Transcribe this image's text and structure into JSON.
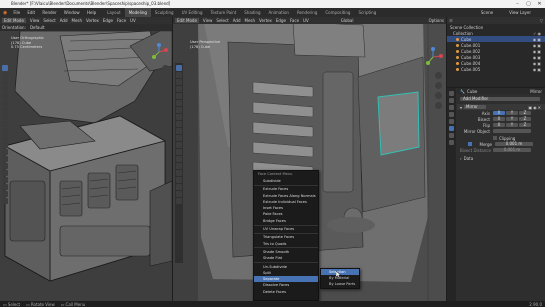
{
  "window": {
    "title": "Blender* [F:\\Vlaicu\\Blender\\Documents\\Blender\\Spaceship\\spaceship_03.blend]",
    "icons": [
      "min-icon",
      "max-icon",
      "close-icon"
    ]
  },
  "menu": [
    "File",
    "Edit",
    "Render",
    "Window",
    "Help"
  ],
  "tabs": [
    "Layout",
    "Modeling",
    "Sculpting",
    "UV Editing",
    "Texture Paint",
    "Shading",
    "Animation",
    "Rendering",
    "Compositing",
    "Scripting"
  ],
  "active_tab": "Modeling",
  "scene": {
    "label": "Scene",
    "view_layer": "View Layer"
  },
  "left_viewport": {
    "header": [
      "Edit Mode",
      "View",
      "Select",
      "Add",
      "Mesh",
      "Vertex",
      "Edge",
      "Face",
      "UV"
    ],
    "orientation": "Orientation:",
    "default_label": "Default",
    "info_lines": [
      "User Orthographic",
      "(178) Cube",
      "0.75 Centimeters"
    ]
  },
  "right_viewport": {
    "header": [
      "Edit Mode",
      "View",
      "Select",
      "Add",
      "Mesh",
      "Vertex",
      "Edge",
      "Face",
      "UV"
    ],
    "global_label": "Global",
    "options_label": "Options",
    "info_lines": [
      "User Perspective",
      "(178) Cube"
    ]
  },
  "context_menu": {
    "title": "Face Context Menu",
    "items": [
      "Subdivide",
      "Extrude Faces",
      "Extrude Faces Along Normals",
      "Extrude Individual Faces",
      "Inset Faces",
      "Poke Faces",
      "Bridge Faces",
      "UV Unwrap Faces",
      "Triangulate Faces",
      "Tris to Quads",
      "Shade Smooth",
      "Shade Flat",
      "Un-Subdivide",
      "Split",
      "Separate",
      "Dissolve Faces",
      "Delete Faces"
    ],
    "highlighted": "Separate"
  },
  "submenu": {
    "items": [
      "Selection",
      "By Material",
      "By Loose Parts"
    ],
    "highlighted": "Selection"
  },
  "outliner": {
    "root": "Scene Collection",
    "collection": "Collection",
    "items": [
      "Cube",
      "Cube.001",
      "Cube.002",
      "Cube.003",
      "Cube.004",
      "Cube.005"
    ]
  },
  "properties": {
    "object": "Cube",
    "modifier_tab": "Mirror",
    "add_modifier": "Add Modifier",
    "modifier_name": "Mirror",
    "axis_label": "Axis",
    "bisect_label": "Bisect",
    "flip_label": "Flip",
    "axes": [
      "X",
      "Y",
      "Z"
    ],
    "mirror_object_label": "Mirror Object",
    "clipping_label": "Clipping",
    "merge_label": "Merge",
    "merge_value": "0.001 m",
    "bisect_distance_label": "Bisect Distance",
    "bisect_distance_value": "0.001 m",
    "data_label": "Data"
  },
  "status": {
    "items": [
      "Select",
      "Rotate View",
      "Call Menu"
    ],
    "version": "2.90.0"
  },
  "colors": {
    "accent": "#4772b3",
    "selection": "#e39b3a",
    "edge": "#2fc3b6"
  }
}
